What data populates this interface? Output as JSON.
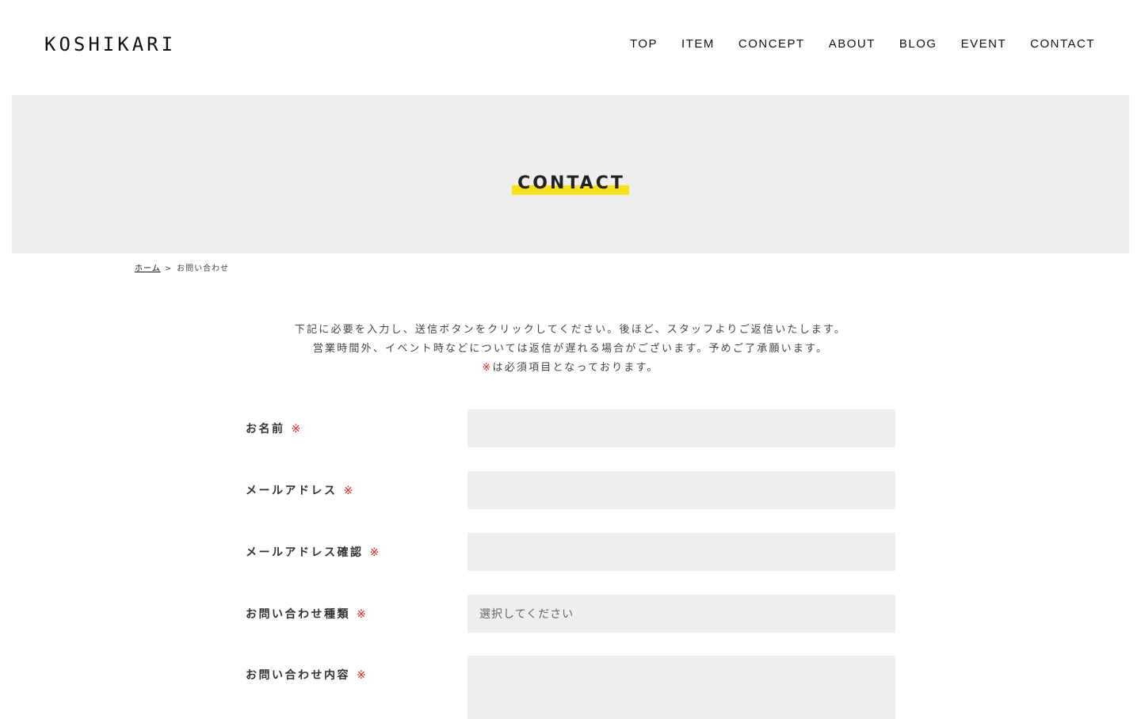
{
  "header": {
    "logo": "KOSHIKARI",
    "nav": [
      "TOP",
      "ITEM",
      "CONCEPT",
      "ABOUT",
      "BLOG",
      "EVENT",
      "CONTACT"
    ]
  },
  "hero": {
    "title": "CONTACT",
    "highlight_color": "#f5e118"
  },
  "breadcrumb": {
    "home": "ホーム",
    "separator": ">",
    "current": "お問い合わせ"
  },
  "intro": {
    "line1": "下記に必要を入力し、送信ボタンをクリックしてください。後ほど、スタッフよりご返信いたします。",
    "line2": "営業時間外、イベント時などについては返信が遅れる場合がございます。予めご了承願います。",
    "required_mark": "※",
    "line3": "は必須項目となっております。"
  },
  "form": {
    "required_mark": "※",
    "required_color": "#e0251c",
    "fields": [
      {
        "label": "お名前",
        "type": "text",
        "value": ""
      },
      {
        "label": "メールアドレス",
        "type": "email",
        "value": ""
      },
      {
        "label": "メールアドレス確認",
        "type": "email",
        "value": ""
      },
      {
        "label": "お問い合わせ種類",
        "type": "select",
        "value": "選択してください"
      },
      {
        "label": "お問い合わせ内容",
        "type": "textarea",
        "value": ""
      }
    ]
  }
}
